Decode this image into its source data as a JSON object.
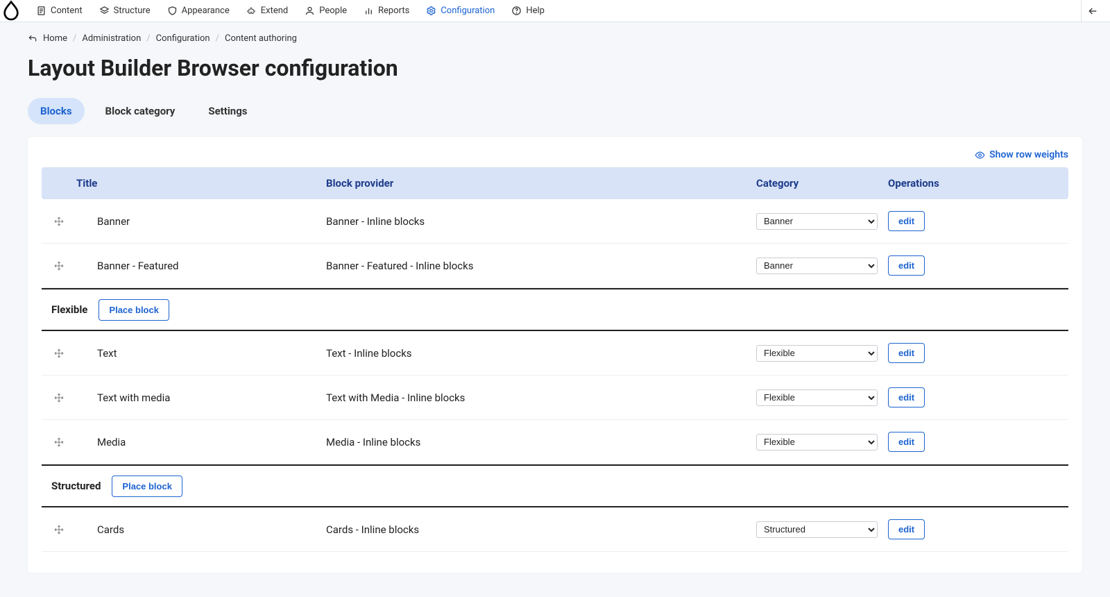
{
  "topbar": {
    "items": [
      {
        "label": "Content"
      },
      {
        "label": "Structure"
      },
      {
        "label": "Appearance"
      },
      {
        "label": "Extend"
      },
      {
        "label": "People"
      },
      {
        "label": "Reports"
      },
      {
        "label": "Configuration"
      },
      {
        "label": "Help"
      }
    ]
  },
  "breadcrumb": {
    "items": [
      {
        "label": "Home"
      },
      {
        "label": "Administration"
      },
      {
        "label": "Configuration"
      },
      {
        "label": "Content authoring"
      }
    ]
  },
  "page_title": "Layout Builder Browser configuration",
  "tabs": {
    "items": [
      {
        "label": "Blocks"
      },
      {
        "label": "Block category"
      },
      {
        "label": "Settings"
      }
    ]
  },
  "show_row_weights": "Show row weights",
  "table_headers": {
    "title": "Title",
    "provider": "Block provider",
    "category": "Category",
    "operations": "Operations"
  },
  "edit_label": "edit",
  "place_block_label": "Place block",
  "category_options": [
    "Banner",
    "Flexible",
    "Structured"
  ],
  "rows": [
    {
      "type": "row",
      "title": "Banner",
      "provider": "Banner - Inline blocks",
      "category": "Banner"
    },
    {
      "type": "row",
      "title": "Banner - Featured",
      "provider": "Banner - Featured - Inline blocks",
      "category": "Banner"
    },
    {
      "type": "group",
      "title": "Flexible"
    },
    {
      "type": "row",
      "title": "Text",
      "provider": "Text - Inline blocks",
      "category": "Flexible"
    },
    {
      "type": "row",
      "title": "Text with media",
      "provider": "Text with Media - Inline blocks",
      "category": "Flexible"
    },
    {
      "type": "row",
      "title": "Media",
      "provider": "Media - Inline blocks",
      "category": "Flexible"
    },
    {
      "type": "group",
      "title": "Structured"
    },
    {
      "type": "row",
      "title": "Cards",
      "provider": "Cards - Inline blocks",
      "category": "Structured"
    }
  ]
}
